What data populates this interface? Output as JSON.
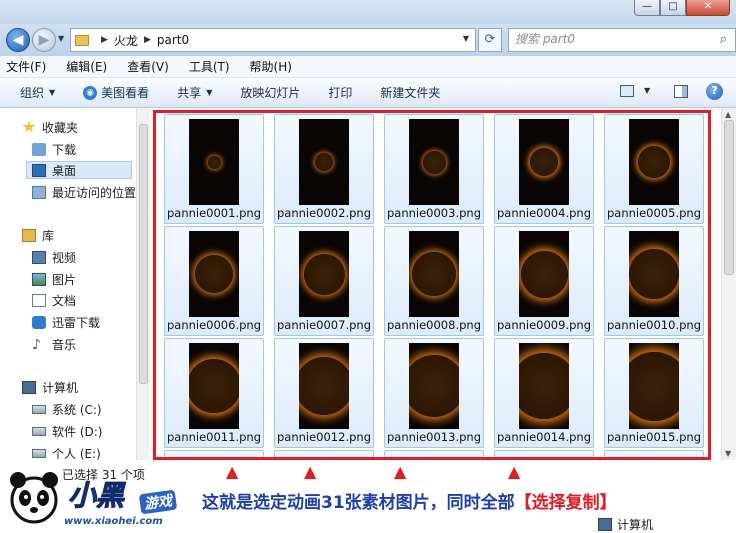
{
  "titlebar": {
    "buttons": {
      "minimize": "—",
      "maximize": "□",
      "close": "✕"
    }
  },
  "address": {
    "crumbs": [
      "火龙",
      "part0"
    ],
    "search_placeholder": "搜索 part0"
  },
  "menu": [
    "文件(F)",
    "编辑(E)",
    "查看(V)",
    "工具(T)",
    "帮助(H)"
  ],
  "commands": {
    "organize": "组织",
    "meitu": "美图看看",
    "share": "共享",
    "slideshow": "放映幻灯片",
    "print": "打印",
    "new_folder": "新建文件夹"
  },
  "nav": {
    "favorites": "收藏夹",
    "downloads": "下载",
    "desktop": "桌面",
    "recent": "最近访问的位置",
    "libraries": "库",
    "videos": "视频",
    "pictures": "图片",
    "documents": "文档",
    "thunder": "迅雷下载",
    "music": "音乐",
    "computer": "计算机",
    "drive_c": "系统 (C:)",
    "drive_d": "软件 (D:)",
    "drive_e": "个人 (E:)"
  },
  "files": [
    {
      "name": "pannie0001.png",
      "ring": 0.12
    },
    {
      "name": "pannie0002.png",
      "ring": 0.26
    },
    {
      "name": "pannie0003.png",
      "ring": 0.4
    },
    {
      "name": "pannie0004.png",
      "ring": 0.52
    },
    {
      "name": "pannie0005.png",
      "ring": 0.64
    },
    {
      "name": "pannie0006.png",
      "ring": 0.78
    },
    {
      "name": "pannie0007.png",
      "ring": 0.86
    },
    {
      "name": "pannie0008.png",
      "ring": 0.94
    },
    {
      "name": "pannie0009.png",
      "ring": 1.02
    },
    {
      "name": "pannie0010.png",
      "ring": 1.1
    },
    {
      "name": "pannie0011.png",
      "ring": 1.22
    },
    {
      "name": "pannie0012.png",
      "ring": 1.32
    },
    {
      "name": "pannie0013.png",
      "ring": 1.42
    },
    {
      "name": "pannie0014.png",
      "ring": 1.52
    },
    {
      "name": "pannie0015.png",
      "ring": 1.6
    }
  ],
  "status": {
    "selected": "已选择 31 个项",
    "location": "计算机"
  },
  "caption": {
    "main": "这就是选定动画31张素材图片，同时全部",
    "highlight": "【选择复制】"
  },
  "watermark": {
    "title": "小黑",
    "sub": "游戏",
    "url": "www.xiaohei.com"
  },
  "colors": {
    "selection_frame": "#e21b24",
    "caption_text": "#1f3fa6",
    "tile_fill": "#dcebfb"
  }
}
